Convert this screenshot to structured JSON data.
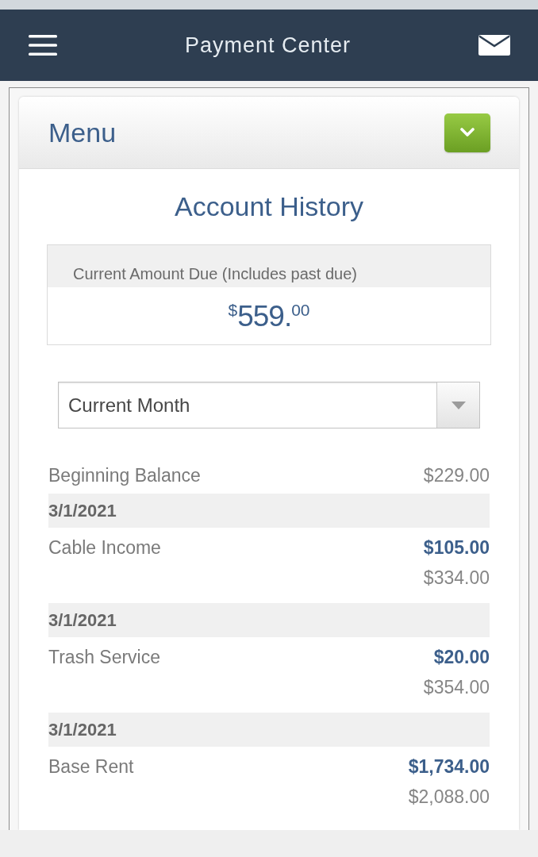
{
  "header": {
    "title": "Payment Center"
  },
  "menu": {
    "title": "Menu",
    "expanded": false
  },
  "account_history": {
    "title": "Account History",
    "amount_due": {
      "label": "Current Amount Due (Includes past due)",
      "currency": "$",
      "whole": "559.",
      "cents": "00"
    },
    "period_select": {
      "value": "Current Month"
    },
    "beginning_balance": {
      "label": "Beginning Balance",
      "amount": "$229.00"
    },
    "transactions": [
      {
        "date": "3/1/2021",
        "description": "Cable Income",
        "amount": "$105.00",
        "balance": "$334.00"
      },
      {
        "date": "3/1/2021",
        "description": "Trash Service",
        "amount": "$20.00",
        "balance": "$354.00"
      },
      {
        "date": "3/1/2021",
        "description": "Base Rent",
        "amount": "$1,734.00",
        "balance": "$2,088.00"
      }
    ]
  }
}
